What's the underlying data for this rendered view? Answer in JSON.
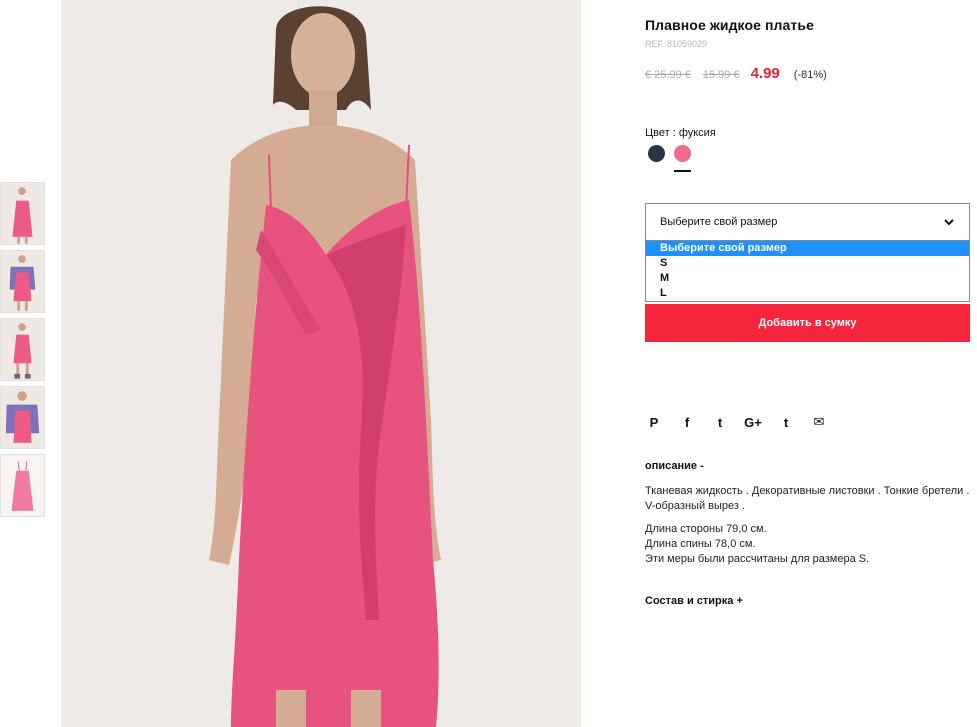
{
  "product": {
    "title": "Плавное жидкое платье",
    "ref": "REF. 81059029",
    "old_price_1": "€ 25.99 €",
    "old_price_2": "15.99 €",
    "price": "4.99",
    "discount": "(-81%)",
    "color_label": "Цвет : фуксия",
    "colors": [
      "#2b3446",
      "#ee6a8f"
    ],
    "accent": "#f5263b"
  },
  "size": {
    "placeholder": "Выберите свой размер",
    "options": [
      "Выберите свой размер",
      "S",
      "M",
      "L"
    ]
  },
  "buttons": {
    "add_to_bag": "Добавить в сумку"
  },
  "social": {
    "pinterest": "P",
    "facebook": "f",
    "twitter": "t",
    "google": "G+",
    "tumblr": "t",
    "email": "✉"
  },
  "description": {
    "heading": "описание -",
    "text": "Тканевая жидкость . Декоративные листовки . Тонкие бретели . V-образный вырез .",
    "measure_1": "Длина стороны 79,0 см.",
    "measure_2": "Длина спины 78,0 см.",
    "measure_3": "Эти меры были рассчитаны для размера S.",
    "care_heading": "Состав и стирка +"
  }
}
